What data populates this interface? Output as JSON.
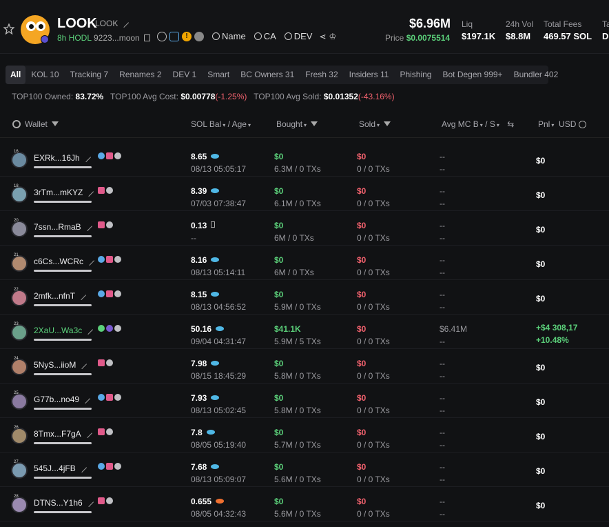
{
  "token": {
    "name": "LOOK",
    "ticker": "LOOK",
    "age_label": "8h HODL",
    "contract": "9223...moon",
    "links": [
      "Name",
      "CA",
      "DEV"
    ]
  },
  "stats": {
    "market_cap": "$6.96M",
    "price_label": "Price",
    "price": "$0.0075514",
    "liq_label": "Liq",
    "liq": "$197.1K",
    "vol_label": "24h Vol",
    "vol": "$8.8M",
    "fees_label": "Total Fees",
    "fees": "469.57 SOL",
    "extra_label": "Ta",
    "extra_val": "D"
  },
  "tabs": [
    {
      "label": "All",
      "active": true
    },
    {
      "label": "KOL 10"
    },
    {
      "label": "Tracking 7"
    },
    {
      "label": "Renames 2"
    },
    {
      "label": "DEV 1"
    },
    {
      "label": "Smart"
    },
    {
      "label": "BC Owners 31"
    },
    {
      "label": "Fresh 32"
    },
    {
      "label": "Insiders 11"
    },
    {
      "label": "Phishing"
    },
    {
      "label": "Bot Degen 999+"
    },
    {
      "label": "Bundler 402"
    }
  ],
  "summary": {
    "owned_label": "TOP100 Owned:",
    "owned": "83.72%",
    "avg_cost_label": "TOP100 Avg Cost:",
    "avg_cost": "$0.00778",
    "avg_cost_pct": "(-1.25%)",
    "avg_sold_label": "TOP100 Avg Sold:",
    "avg_sold": "$0.01352",
    "avg_sold_pct": "(-43.16%)"
  },
  "columns": {
    "wallet": "Wallet",
    "sol_bal": "SOL Bal",
    "age": "/ Age",
    "bought": "Bought",
    "sold": "Sold",
    "avg_mc": "Avg MC B",
    "avg_s": "/ S",
    "pnl": "Pnl",
    "usd": "USD"
  },
  "rows": [
    {
      "rank": "16",
      "wallet": "EXRk...16Jh",
      "tags": [
        "blue",
        "red",
        "grey"
      ],
      "bal": "8.65",
      "fish": "blue",
      "time": "08/13 05:05:17",
      "bought": "$0",
      "bought_sub": "6.3M / 0 TXs",
      "sold": "$0",
      "sold_sub": "0 / 0 TXs",
      "avg1": "--",
      "avg2": "--",
      "pnl": "$0"
    },
    {
      "rank": "18",
      "wallet": "3rTm...mKYZ",
      "tags": [
        "red",
        "grey"
      ],
      "bal": "8.39",
      "fish": "blue",
      "time": "07/03 07:38:47",
      "bought": "$0",
      "bought_sub": "6.1M / 0 TXs",
      "sold": "$0",
      "sold_sub": "0 / 0 TXs",
      "avg1": "--",
      "avg2": "--",
      "pnl": "$0"
    },
    {
      "rank": "20",
      "wallet": "7ssn...RmaB",
      "tags": [
        "red",
        "grey"
      ],
      "bal": "0.13",
      "fish": "box",
      "time": "--",
      "bought": "$0",
      "bought_sub": "6M / 0 TXs",
      "sold": "$0",
      "sold_sub": "0 / 0 TXs",
      "avg1": "--",
      "avg2": "--",
      "pnl": "$0"
    },
    {
      "rank": "21",
      "wallet": "c6Cs...WCRc",
      "tags": [
        "blue",
        "red",
        "grey"
      ],
      "bal": "8.16",
      "fish": "blue",
      "time": "08/13 05:14:11",
      "bought": "$0",
      "bought_sub": "6M / 0 TXs",
      "sold": "$0",
      "sold_sub": "0 / 0 TXs",
      "avg1": "--",
      "avg2": "--",
      "pnl": "$0"
    },
    {
      "rank": "22",
      "wallet": "2mfk...nfnT",
      "tags": [
        "blue",
        "red",
        "grey"
      ],
      "bal": "8.15",
      "fish": "blue",
      "time": "08/13 04:56:52",
      "bought": "$0",
      "bought_sub": "5.9M / 0 TXs",
      "sold": "$0",
      "sold_sub": "0 / 0 TXs",
      "avg1": "--",
      "avg2": "--",
      "pnl": "$0"
    },
    {
      "rank": "23",
      "wallet": "2XaU...Wa3c",
      "green": true,
      "tags": [
        "green",
        "purple",
        "grey"
      ],
      "bal": "50.16",
      "fish": "blue",
      "time": "09/04 04:31:47",
      "bought": "$41.1K",
      "bought_sub": "5.9M / 5 TXs",
      "sold": "$0",
      "sold_sub": "0 / 0 TXs",
      "avg1": "$6.41M",
      "avg2": "--",
      "pnl": "+$4 308,17",
      "pnl2": "+10.48%"
    },
    {
      "rank": "24",
      "wallet": "5NyS...iioM",
      "tags": [
        "red",
        "grey"
      ],
      "bal": "7.98",
      "fish": "blue",
      "time": "08/15 18:45:29",
      "bought": "$0",
      "bought_sub": "5.8M / 0 TXs",
      "sold": "$0",
      "sold_sub": "0 / 0 TXs",
      "avg1": "--",
      "avg2": "--",
      "pnl": "$0"
    },
    {
      "rank": "25",
      "wallet": "G77b...no49",
      "tags": [
        "blue",
        "red",
        "grey"
      ],
      "bal": "7.93",
      "fish": "blue",
      "time": "08/13 05:02:45",
      "bought": "$0",
      "bought_sub": "5.8M / 0 TXs",
      "sold": "$0",
      "sold_sub": "0 / 0 TXs",
      "avg1": "--",
      "avg2": "--",
      "pnl": "$0"
    },
    {
      "rank": "26",
      "wallet": "8Tmx...F7gA",
      "tags": [
        "red",
        "grey"
      ],
      "bal": "7.8",
      "fish": "blue",
      "time": "08/05 05:19:40",
      "bought": "$0",
      "bought_sub": "5.7M / 0 TXs",
      "sold": "$0",
      "sold_sub": "0 / 0 TXs",
      "avg1": "--",
      "avg2": "--",
      "pnl": "$0"
    },
    {
      "rank": "27",
      "wallet": "545J...4jFB",
      "tags": [
        "blue",
        "red",
        "grey"
      ],
      "bal": "7.68",
      "fish": "blue",
      "time": "08/13 05:09:07",
      "bought": "$0",
      "bought_sub": "5.6M / 0 TXs",
      "sold": "$0",
      "sold_sub": "0 / 0 TXs",
      "avg1": "--",
      "avg2": "--",
      "pnl": "$0"
    },
    {
      "rank": "28",
      "wallet": "DTNS...Y1h6",
      "tags": [
        "red",
        "grey"
      ],
      "bal": "0.655",
      "fish": "orange",
      "time": "08/05 04:32:43",
      "bought": "$0",
      "bought_sub": "5.6M / 0 TXs",
      "sold": "$0",
      "sold_sub": "0 / 0 TXs",
      "avg1": "--",
      "avg2": "--",
      "pnl": "$0"
    }
  ]
}
